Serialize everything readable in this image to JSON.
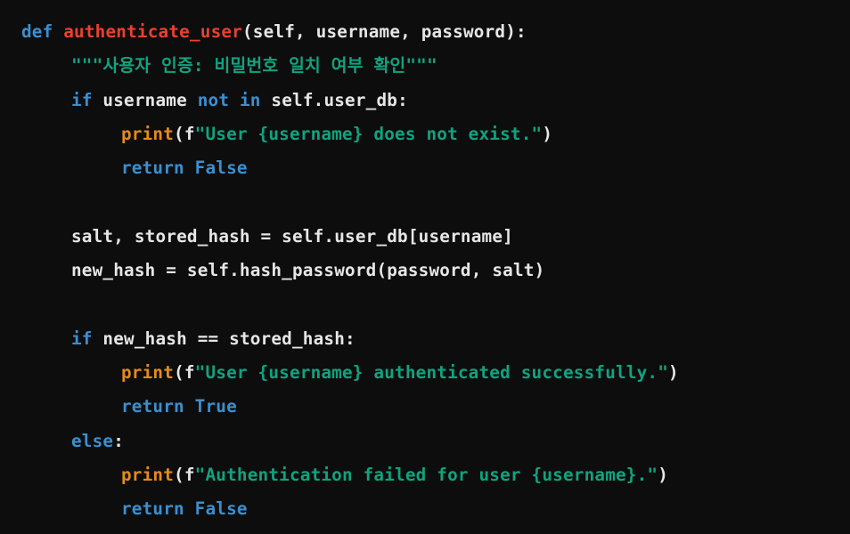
{
  "code": {
    "lines": [
      {
        "indent": 0,
        "tokens": [
          {
            "t": "kw",
            "v": "def"
          },
          {
            "t": "plain",
            "v": " "
          },
          {
            "t": "fn",
            "v": "authenticate_user"
          },
          {
            "t": "plain",
            "v": "(self, username, password):"
          }
        ]
      },
      {
        "indent": 1,
        "tokens": [
          {
            "t": "str",
            "v": "\"\"\"사용자 인증: 비밀번호 일치 여부 확인\"\"\""
          }
        ]
      },
      {
        "indent": 1,
        "tokens": [
          {
            "t": "kw",
            "v": "if"
          },
          {
            "t": "plain",
            "v": " username "
          },
          {
            "t": "kw",
            "v": "not"
          },
          {
            "t": "plain",
            "v": " "
          },
          {
            "t": "kw",
            "v": "in"
          },
          {
            "t": "plain",
            "v": " self.user_db:"
          }
        ]
      },
      {
        "indent": 2,
        "tokens": [
          {
            "t": "bi",
            "v": "print"
          },
          {
            "t": "plain",
            "v": "("
          },
          {
            "t": "plain",
            "v": "f"
          },
          {
            "t": "str",
            "v": "\"User {username} does not exist.\""
          },
          {
            "t": "plain",
            "v": ")"
          }
        ]
      },
      {
        "indent": 2,
        "tokens": [
          {
            "t": "kw",
            "v": "return"
          },
          {
            "t": "plain",
            "v": " "
          },
          {
            "t": "kw",
            "v": "False"
          }
        ]
      },
      {
        "indent": 0,
        "tokens": []
      },
      {
        "indent": 1,
        "tokens": [
          {
            "t": "plain",
            "v": "salt, stored_hash = self.user_db[username]"
          }
        ]
      },
      {
        "indent": 1,
        "tokens": [
          {
            "t": "plain",
            "v": "new_hash = self.hash_password(password, salt)"
          }
        ]
      },
      {
        "indent": 0,
        "tokens": []
      },
      {
        "indent": 1,
        "tokens": [
          {
            "t": "kw",
            "v": "if"
          },
          {
            "t": "plain",
            "v": " new_hash == stored_hash:"
          }
        ]
      },
      {
        "indent": 2,
        "tokens": [
          {
            "t": "bi",
            "v": "print"
          },
          {
            "t": "plain",
            "v": "("
          },
          {
            "t": "plain",
            "v": "f"
          },
          {
            "t": "str",
            "v": "\"User {username} authenticated successfully.\""
          },
          {
            "t": "plain",
            "v": ")"
          }
        ]
      },
      {
        "indent": 2,
        "tokens": [
          {
            "t": "kw",
            "v": "return"
          },
          {
            "t": "plain",
            "v": " "
          },
          {
            "t": "kw",
            "v": "True"
          }
        ]
      },
      {
        "indent": 1,
        "tokens": [
          {
            "t": "kw",
            "v": "else"
          },
          {
            "t": "plain",
            "v": ":"
          }
        ]
      },
      {
        "indent": 2,
        "tokens": [
          {
            "t": "bi",
            "v": "print"
          },
          {
            "t": "plain",
            "v": "("
          },
          {
            "t": "plain",
            "v": "f"
          },
          {
            "t": "str",
            "v": "\"Authentication failed for user {username}.\""
          },
          {
            "t": "plain",
            "v": ")"
          }
        ]
      },
      {
        "indent": 2,
        "tokens": [
          {
            "t": "kw",
            "v": "return"
          },
          {
            "t": "plain",
            "v": " "
          },
          {
            "t": "kw",
            "v": "False"
          }
        ]
      }
    ]
  },
  "colors": {
    "background": "#0d0d0d",
    "keyword": "#3b8fd0",
    "function_name": "#e8412f",
    "string": "#10a37f",
    "builtin": "#e38b1c",
    "plain": "#e6e6e6"
  }
}
